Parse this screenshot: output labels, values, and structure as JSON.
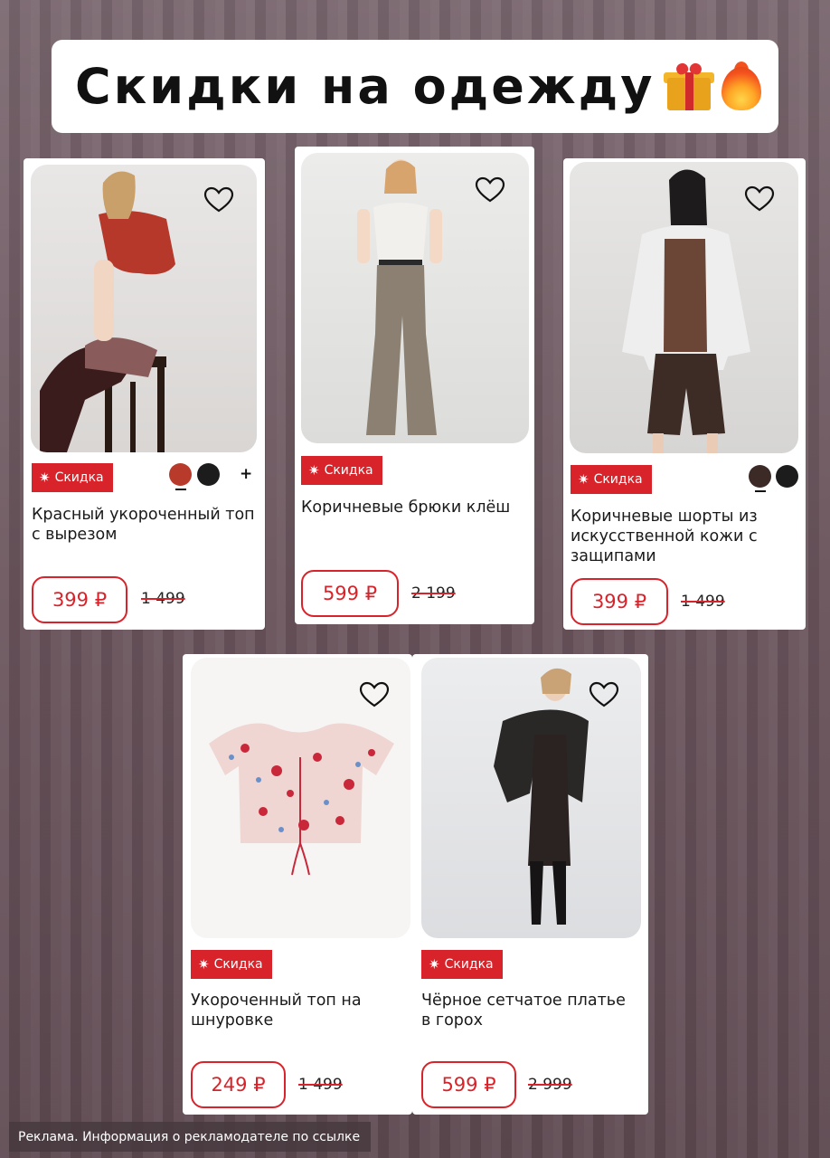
{
  "banner": {
    "title": "Скидки на одежду",
    "emoji_1": "gift-emoji",
    "emoji_2": "fire-emoji"
  },
  "products": [
    {
      "name": "Красный укороченный топ с вырезом",
      "badge": "Скидка",
      "price": "399 ₽",
      "old_price": "1 499",
      "swatches": [
        "#b83a2a",
        "#1c1c1c"
      ],
      "more_colors": "+",
      "image": "model in red cropped top sitting on stool"
    },
    {
      "name": "Коричневые брюки клёш",
      "badge": "Скидка",
      "price": "599 ₽",
      "old_price": "2 199",
      "image": "model in white top and brown flared trousers"
    },
    {
      "name": "Коричневые шорты из искусственной кожи с защипами",
      "badge": "Скидка",
      "price": "399 ₽",
      "old_price": "1 499",
      "swatches": [
        "#3b2a26",
        "#1c1c1c"
      ],
      "image": "model in white jacket and brown leather shorts"
    },
    {
      "name": "Укороченный топ на шнуровке",
      "badge": "Скидка",
      "price": "249 ₽",
      "old_price": "1 499",
      "image": "floral lace-up crop top"
    },
    {
      "name": "Чёрное сетчатое платье в горох",
      "badge": "Скидка",
      "price": "599 ₽",
      "old_price": "2 999",
      "image": "model in black leather jacket and polka dot dress"
    }
  ],
  "disclaimer": "Реклама. Информация о рекламодателе по ссылке",
  "colors": {
    "accent": "#d8232a",
    "background": "#6f5a62"
  }
}
